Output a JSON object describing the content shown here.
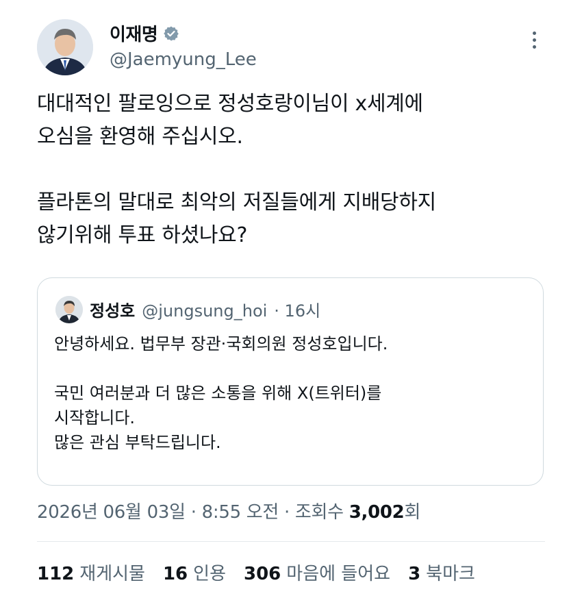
{
  "author": {
    "display_name": "이재명",
    "handle": "@Jaemyung_Lee"
  },
  "tweet": {
    "line1": "대대적인 팔로잉으로 정성호랑이님이 x세계에",
    "line2": "오심을 환영해 주십시오.",
    "line3": "플라톤의 말대로 최악의 저질들에게 지배당하지",
    "line4": "않기위해 투표 하셨나요?"
  },
  "quote": {
    "name": "정성호",
    "handle": "@jungsung_hoi",
    "time": "· 16시",
    "line1": "안녕하세요. 법무부 장관·국회의원 정성호입니다.",
    "line2": "국민 여러분과 더 많은 소통을 위해 X(트위터)를",
    "line3": "시작합니다.",
    "line4": "많은 관심 부탁드립니다."
  },
  "meta": {
    "datetime": "2026년 06월 03일 · 8:55 오전 · 조회수",
    "views": "3,002",
    "views_unit": "회"
  },
  "stats": {
    "retweets_count": "112",
    "retweets_label": "재게시물",
    "quotes_count": "16",
    "quotes_label": "인용",
    "likes_count": "306",
    "likes_label": "마음에 들어요",
    "bookmarks_count": "3",
    "bookmarks_label": "북마크"
  },
  "colors": {
    "text": "#0f1419",
    "muted": "#536471",
    "border": "#cfd9de",
    "verified": "#829aab"
  },
  "icons": {
    "verified": "verified-badge-icon",
    "more": "more-options-icon"
  }
}
